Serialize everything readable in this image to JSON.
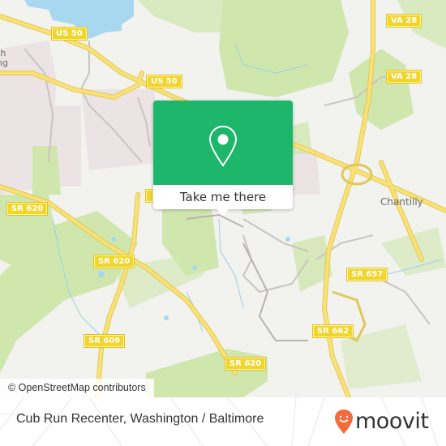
{
  "map": {
    "road_shields": [
      {
        "id": "us50-a",
        "label": "US 50"
      },
      {
        "id": "us50-b",
        "label": "US 50"
      },
      {
        "id": "va28-a",
        "label": "VA 28"
      },
      {
        "id": "va28-b",
        "label": "VA 28"
      },
      {
        "id": "sr620-a",
        "label": "SR 620"
      },
      {
        "id": "sr620-b",
        "label": "SR 620"
      },
      {
        "id": "sr620-c",
        "label": "SR 620"
      },
      {
        "id": "sr609",
        "label": "SR 609"
      },
      {
        "id": "sr657",
        "label": "SR 657"
      },
      {
        "id": "sr662",
        "label": "SR 662"
      }
    ],
    "places": {
      "chantilly": "Chantilly",
      "partial_label_line1": "th",
      "partial_label_line2": "ng"
    },
    "attribution": "© OpenStreetMap contributors",
    "colors": {
      "background": "#f2f2ef",
      "park": "#cfe6ad",
      "water": "#a8d8f0",
      "highway": "#f5dc6a",
      "residential": "#ece4e4"
    }
  },
  "popup": {
    "icon": "location-pin-icon",
    "button_label": "Take me there",
    "accent_color": "#1db66a"
  },
  "footer": {
    "title": "Cub Run Recenter, Washington / Baltimore",
    "logo_text": "moovit",
    "logo_icon": "moovit-pin-icon",
    "logo_color": "#f26b3a"
  }
}
